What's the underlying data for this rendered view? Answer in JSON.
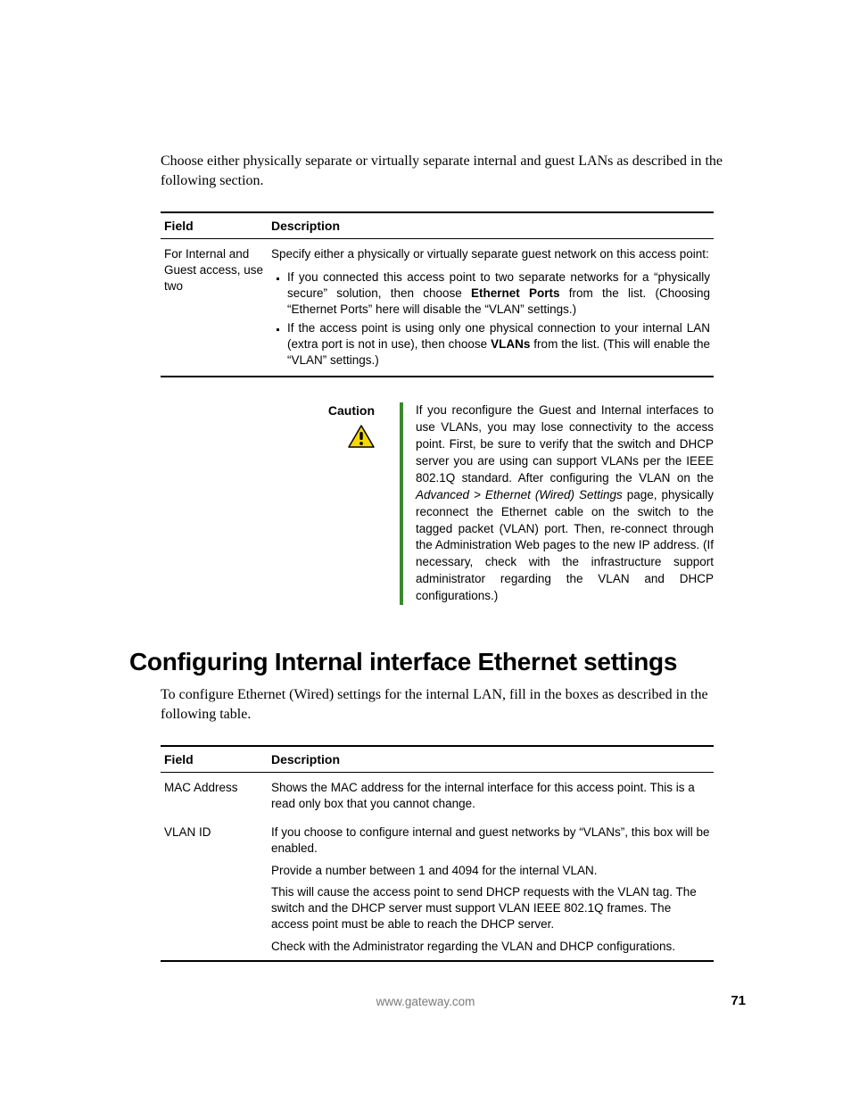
{
  "intro": "Choose either physically separate or virtually separate internal and guest LANs as described in the following section.",
  "table1": {
    "headers": {
      "field": "Field",
      "desc": "Description"
    },
    "row": {
      "field": "For Internal and Guest access, use two",
      "lead": "Specify either a physically or virtually separate guest network on this access point:",
      "b1a": "If you connected this access point to two separate networks for a “physically secure” solution, then choose ",
      "b1b": "Ethernet Ports",
      "b1c": " from the list. (Choosing “Ethernet Ports” here will disable the “VLAN” settings.)",
      "b2a": "If the access point is using only one physical connection to your internal LAN (extra port is not in use), then choose ",
      "b2b": "VLANs",
      "b2c": " from the list. (This will enable the “VLAN” settings.)"
    }
  },
  "caution": {
    "label": "Caution",
    "p1": "If you reconfigure the Guest and Internal interfaces to use VLANs, you may lose connectivity to the access point. First, be sure to verify that the switch and DHCP server you are using can support VLANs per the IEEE 802.1Q standard. After configuring the VLAN on the ",
    "it": "Advanced > Ethernet (Wired) Settings",
    "p2": " page, physically reconnect the Ethernet cable on the switch to the tagged packet (VLAN) port. Then, re-connect through the Administration Web pages to the new IP address. (If necessary, check with the infrastructure support administrator regarding the VLAN and DHCP configurations.)"
  },
  "heading": "Configuring Internal interface Ethernet settings",
  "intro2": "To configure Ethernet (Wired) settings for the internal LAN, fill in the boxes as described in the following table.",
  "table2": {
    "headers": {
      "field": "Field",
      "desc": "Description"
    },
    "rows": [
      {
        "field": "MAC Address",
        "paras": [
          "Shows the MAC address for the internal interface for this access point. This is a read only box that you cannot change."
        ]
      },
      {
        "field": "VLAN ID",
        "paras": [
          "If you choose to configure internal and guest networks by “VLANs”, this box will be enabled.",
          "Provide a number between 1 and 4094 for the internal VLAN.",
          "This will cause the access point to send DHCP requests with the VLAN tag. The switch and the DHCP server must support VLAN IEEE 802.1Q frames. The access point must be able to reach the DHCP server.",
          "Check with the Administrator regarding the VLAN and DHCP configurations."
        ]
      }
    ]
  },
  "footer": "www.gateway.com",
  "pagenum": "71"
}
